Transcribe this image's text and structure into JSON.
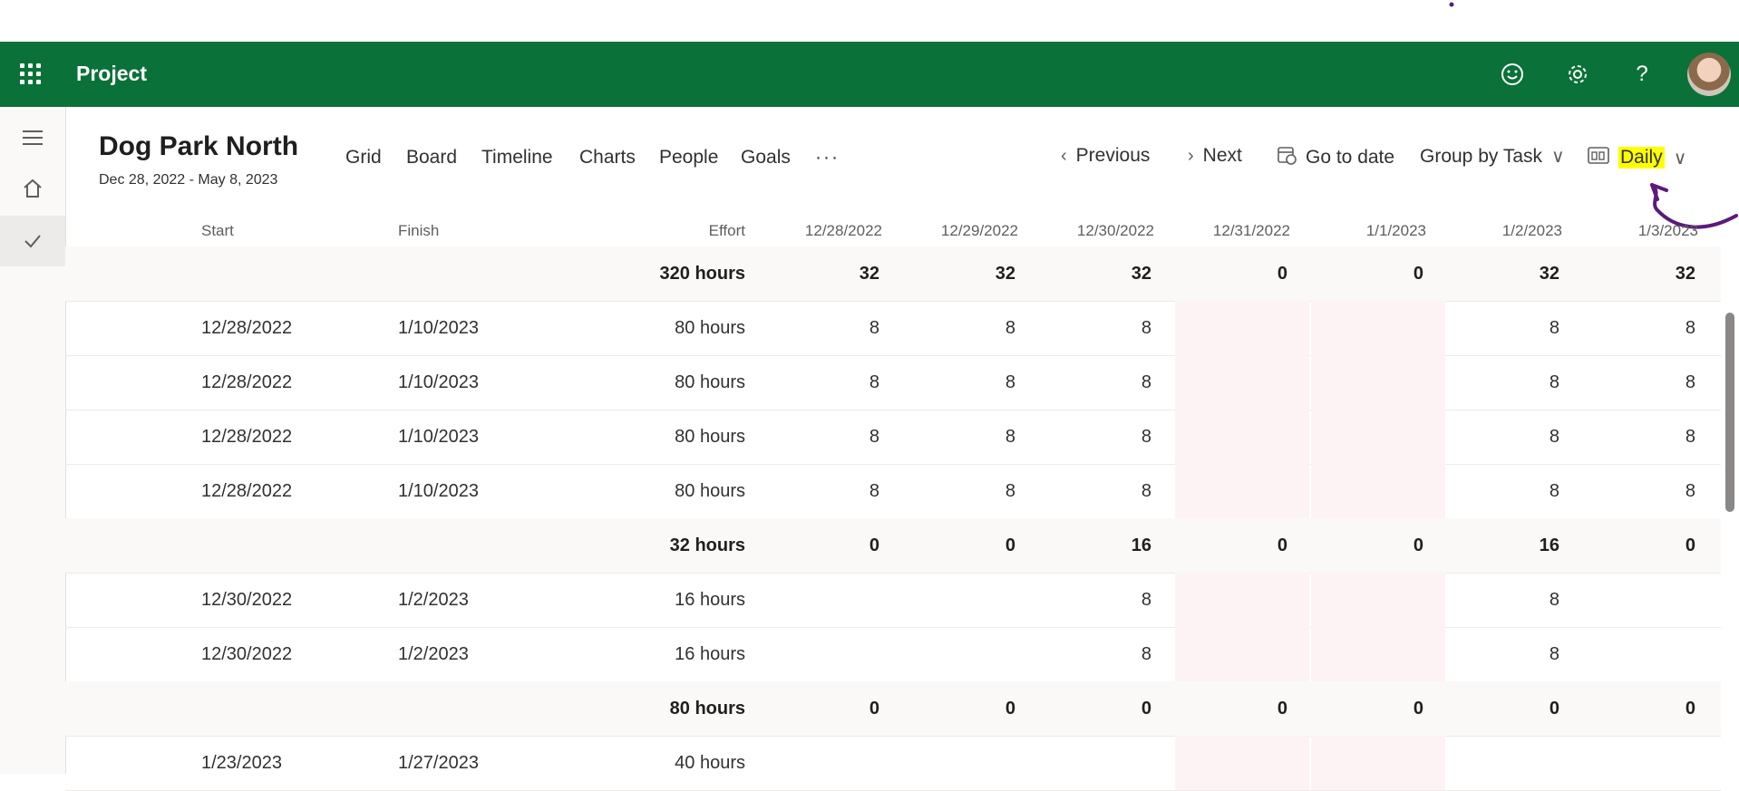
{
  "app": {
    "name": "Project"
  },
  "header_icons": [
    "smiley-icon",
    "gear-icon",
    "help-icon",
    "avatar"
  ],
  "help_glyph": "?",
  "project": {
    "title": "Dog Park North",
    "dates": "Dec 28, 2022 - May 8, 2023"
  },
  "tabs": [
    "Grid",
    "Board",
    "Timeline",
    "Charts",
    "People",
    "Goals"
  ],
  "more": "···",
  "controls": {
    "previous": "Previous",
    "next": "Next",
    "go_to_date": "Go to date",
    "group_by": "Group by Task",
    "view": "Daily"
  },
  "columns": {
    "start": "Start",
    "finish": "Finish",
    "effort": "Effort",
    "dates": [
      "12/28/2022",
      "12/29/2022",
      "12/30/2022",
      "12/31/2022",
      "1/1/2023",
      "1/2/2023",
      "1/3/2023"
    ]
  },
  "rows": [
    {
      "summary": true,
      "start": "",
      "finish": "",
      "effort": "320 hours",
      "days": [
        "32",
        "32",
        "32",
        "0",
        "0",
        "32",
        "32"
      ]
    },
    {
      "summary": false,
      "start": "12/28/2022",
      "finish": "1/10/2023",
      "effort": "80 hours",
      "days": [
        "8",
        "8",
        "8",
        "",
        "",
        "8",
        "8"
      ]
    },
    {
      "summary": false,
      "start": "12/28/2022",
      "finish": "1/10/2023",
      "effort": "80 hours",
      "days": [
        "8",
        "8",
        "8",
        "",
        "",
        "8",
        "8"
      ]
    },
    {
      "summary": false,
      "start": "12/28/2022",
      "finish": "1/10/2023",
      "effort": "80 hours",
      "days": [
        "8",
        "8",
        "8",
        "",
        "",
        "8",
        "8"
      ]
    },
    {
      "summary": false,
      "start": "12/28/2022",
      "finish": "1/10/2023",
      "effort": "80 hours",
      "days": [
        "8",
        "8",
        "8",
        "",
        "",
        "8",
        "8"
      ]
    },
    {
      "summary": true,
      "start": "",
      "finish": "",
      "effort": "32 hours",
      "days": [
        "0",
        "0",
        "16",
        "0",
        "0",
        "16",
        "0"
      ]
    },
    {
      "summary": false,
      "start": "12/30/2022",
      "finish": "1/2/2023",
      "effort": "16 hours",
      "days": [
        "",
        "",
        "8",
        "",
        "",
        "8",
        ""
      ]
    },
    {
      "summary": false,
      "start": "12/30/2022",
      "finish": "1/2/2023",
      "effort": "16 hours",
      "days": [
        "",
        "",
        "8",
        "",
        "",
        "8",
        ""
      ]
    },
    {
      "summary": true,
      "start": "",
      "finish": "",
      "effort": "80 hours",
      "days": [
        "0",
        "0",
        "0",
        "0",
        "0",
        "0",
        "0"
      ]
    },
    {
      "summary": false,
      "start": "1/23/2023",
      "finish": "1/27/2023",
      "effort": "40 hours",
      "days": [
        "",
        "",
        "",
        "",
        "",
        "",
        ""
      ]
    }
  ],
  "colors": {
    "brand": "#0a7139",
    "weekend": "#fdf3f4",
    "highlight": "#ffff00",
    "annotation": "#5c1a7a"
  }
}
